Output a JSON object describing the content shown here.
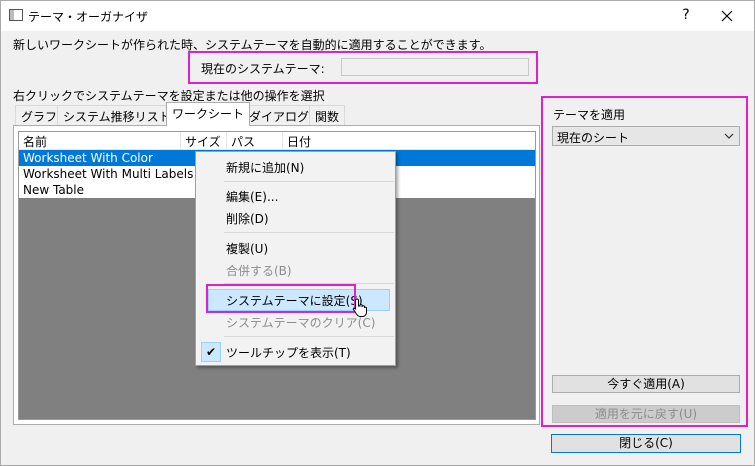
{
  "window": {
    "title": "テーマ・オーガナイザ",
    "help_label": "?"
  },
  "description": "新しいワークシートが作られた時、システムテーマを自動的に適用することができます。",
  "current_theme": {
    "label": "現在のシステムテーマ:",
    "value": ""
  },
  "instruction": "右クリックでシステムテーマを設定または他の操作を選択",
  "tabs": [
    {
      "label": "グラフ"
    },
    {
      "label": "システム推移リスト"
    },
    {
      "label": "ワークシート"
    },
    {
      "label": "ダイアログ"
    },
    {
      "label": "関数"
    }
  ],
  "active_tab": "ワークシート",
  "list": {
    "columns": [
      "名前",
      "サイズ",
      "パス",
      "日付"
    ],
    "rows": [
      {
        "name": "Worksheet With Color",
        "selected": true
      },
      {
        "name": "Worksheet With Multi Labels",
        "selected": false
      },
      {
        "name": "New Table",
        "selected": false
      }
    ]
  },
  "context_menu": {
    "items": [
      {
        "label": "新規に追加(N)",
        "enabled": true
      },
      {
        "label": "編集(E)...",
        "enabled": true
      },
      {
        "label": "削除(D)",
        "enabled": true
      },
      {
        "label": "複製(U)",
        "enabled": true
      },
      {
        "label": "合併する(B)",
        "enabled": false
      },
      {
        "label": "システムテーマに設定(S)",
        "enabled": true,
        "highlighted": true
      },
      {
        "label": "システムテーマのクリア(C)",
        "enabled": false
      },
      {
        "label": "ツールチップを表示(T)",
        "enabled": true,
        "checked": true
      }
    ],
    "check_mark": "✔"
  },
  "apply_panel": {
    "label": "テーマを適用",
    "target_value": "現在のシート",
    "apply_now_label": "今すぐ適用(A)",
    "revert_label": "適用を元に戻す(U)"
  },
  "close_label": "閉じる(C)",
  "colors": {
    "highlight_border": "#e020c8",
    "selection": "#0078d7",
    "menu_highlight": "#cce8ff"
  }
}
